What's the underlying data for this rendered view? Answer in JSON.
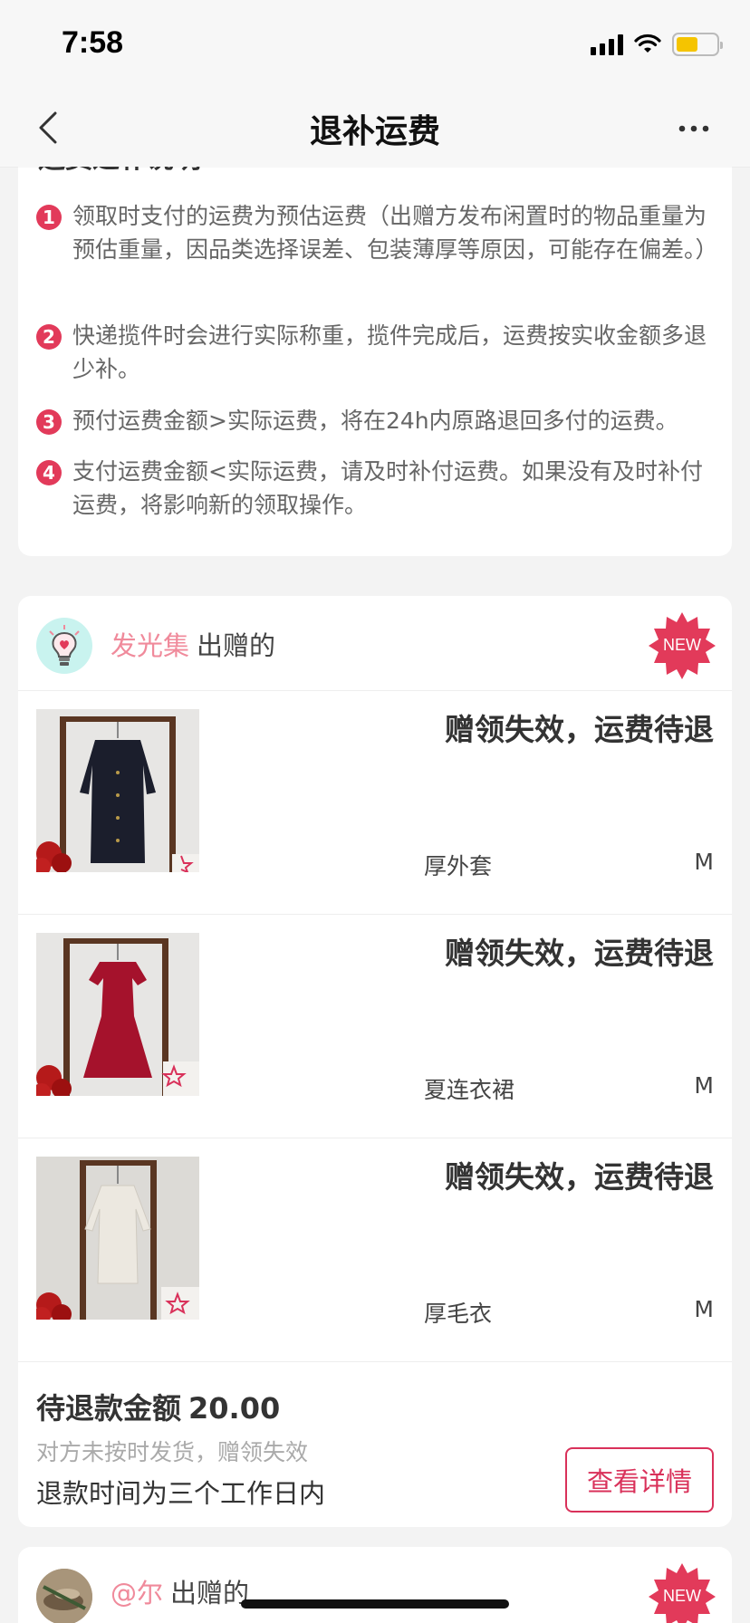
{
  "status_bar": {
    "time": "7:58"
  },
  "nav": {
    "title": "退补运费"
  },
  "rules": {
    "title": "运费退补说明",
    "items": [
      {
        "num": "1",
        "text": "领取时支付的运费为预估运费（出赠方发布闲置时的物品重量为预估重量，因品类选择误差、包装薄厚等原因，可能存在偏差。）"
      },
      {
        "num": "2",
        "text": "快递揽件时会进行实际称重，揽件完成后，运费按实收金额多退少补。"
      },
      {
        "num": "3",
        "text": "预付运费金额>实际运费，将在24h内原路退回多付的运费。"
      },
      {
        "num": "4",
        "text": "支付运费金额<实际运费，请及时补付运费。如果没有及时补付运费，将影响新的领取操作。"
      }
    ]
  },
  "order": {
    "giver_name": "发光集",
    "giver_suffix": "出赠的",
    "badge": "NEW",
    "items": [
      {
        "status": "赠领失效，运费待退",
        "name": "厚外套",
        "size": "M",
        "color": "#1b1e2c"
      },
      {
        "status": "赠领失效，运费待退",
        "name": "夏连衣裙",
        "size": "M",
        "color": "#a5122c"
      },
      {
        "status": "赠领失效，运费待退",
        "name": "厚毛衣",
        "size": "M",
        "color": "#ece8e0"
      }
    ],
    "refund_label": "待退款金额",
    "refund_amount": "20.00",
    "refund_reason": "对方未按时发货，赠领失效",
    "refund_time": "退款时间为三个工作日内",
    "detail_button": "查看详情"
  },
  "next_order": {
    "giver_name": "@尔",
    "giver_suffix": "出赠的",
    "badge": "NEW"
  },
  "colors": {
    "accent": "#d9315a",
    "giver_name": "#f08a9b",
    "badge": "#e23a5a"
  }
}
